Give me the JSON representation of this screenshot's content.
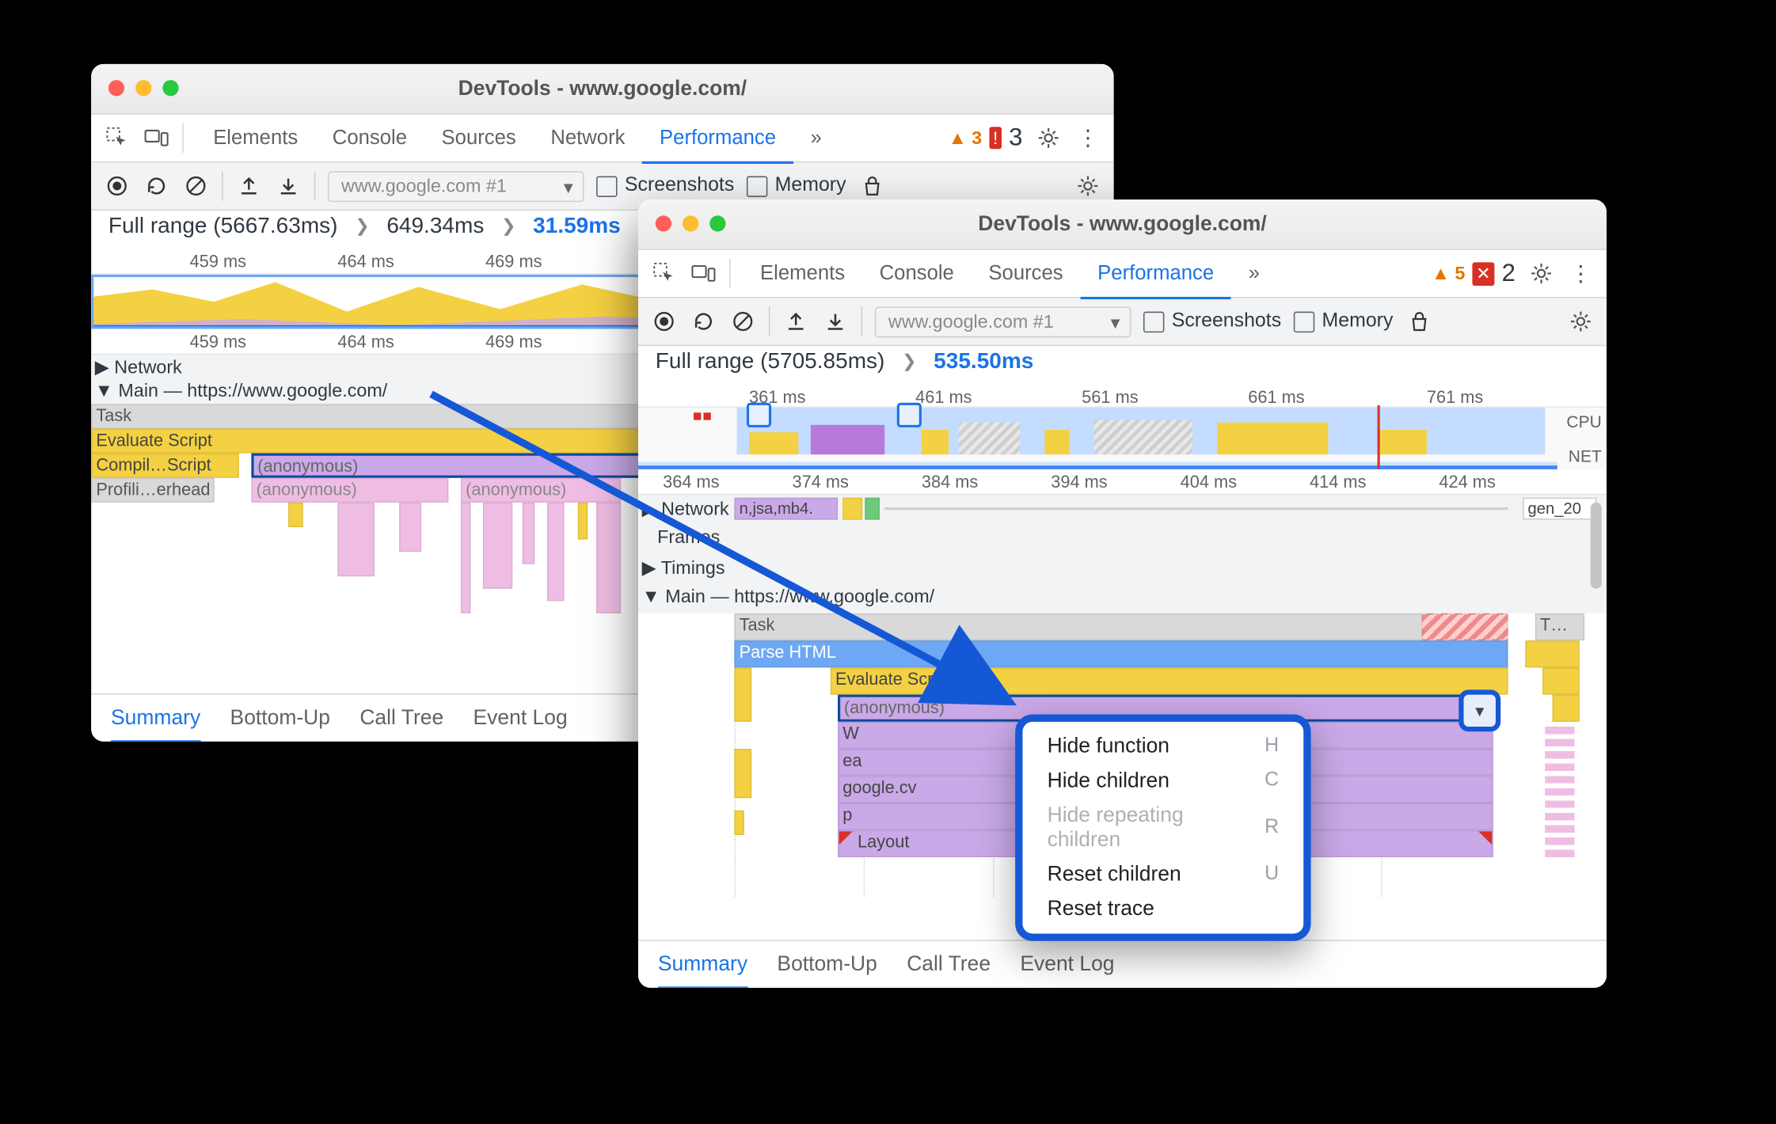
{
  "win1": {
    "title": "DevTools - www.google.com/",
    "tabs": [
      "Elements",
      "Console",
      "Sources",
      "Network",
      "Performance"
    ],
    "overflow": "»",
    "warn_count": "3",
    "err_count": "3",
    "toolbar": {
      "recording": "www.google.com #1",
      "screenshots": "Screenshots",
      "memory": "Memory"
    },
    "breadcrumb": {
      "full": "Full range (5667.63ms)",
      "mid": "649.34ms",
      "cur": "31.59ms"
    },
    "over_ticks": [
      "459 ms",
      "464 ms",
      "469 ms"
    ],
    "ruler_ticks": [
      "459 ms",
      "464 ms",
      "469 ms"
    ],
    "tracks": {
      "network": "Network",
      "main": "Main — https://www.google.com/"
    },
    "rows": {
      "task": "Task",
      "eval": "Evaluate Script",
      "compile": "Compil…Script",
      "anon": "(anonymous)",
      "prof": "Profili…erhead"
    },
    "bottom_tabs": [
      "Summary",
      "Bottom-Up",
      "Call Tree",
      "Event Log"
    ]
  },
  "win2": {
    "title": "DevTools - www.google.com/",
    "tabs": [
      "Elements",
      "Console",
      "Sources",
      "Performance"
    ],
    "overflow": "»",
    "warn_count": "5",
    "err_count": "2",
    "toolbar": {
      "recording": "www.google.com #1",
      "screenshots": "Screenshots",
      "memory": "Memory"
    },
    "breadcrumb": {
      "full": "Full range (5705.85ms)",
      "cur": "535.50ms"
    },
    "over_ticks": [
      "361 ms",
      "461 ms",
      "561 ms",
      "661 ms",
      "761 ms"
    ],
    "side": {
      "cpu": "CPU",
      "net": "NET"
    },
    "ruler_ticks": [
      "364 ms",
      "374 ms",
      "384 ms",
      "394 ms",
      "404 ms",
      "414 ms",
      "424 ms"
    ],
    "tracks": {
      "network": "Network",
      "frames": "Frames",
      "timings": "Timings",
      "main": "Main — https://www.google.com/"
    },
    "net_items": {
      "a": "n,jsa,mb4.",
      "b": "gen_20"
    },
    "rows": {
      "task": "Task",
      "t2": "T…",
      "parse": "Parse HTML",
      "eval": "Evaluate Script",
      "anon": "(anonymous)",
      "w": "W",
      "ea": "ea",
      "cv": "google.cv",
      "p": "p",
      "layout": "Layout"
    },
    "menu": [
      {
        "label": "Hide function",
        "key": "H",
        "dis": false
      },
      {
        "label": "Hide children",
        "key": "C",
        "dis": false
      },
      {
        "label": "Hide repeating children",
        "key": "R",
        "dis": true
      },
      {
        "label": "Reset children",
        "key": "U",
        "dis": false
      },
      {
        "label": "Reset trace",
        "key": "",
        "dis": false
      }
    ],
    "bottom_tabs": [
      "Summary",
      "Bottom-Up",
      "Call Tree",
      "Event Log"
    ]
  }
}
